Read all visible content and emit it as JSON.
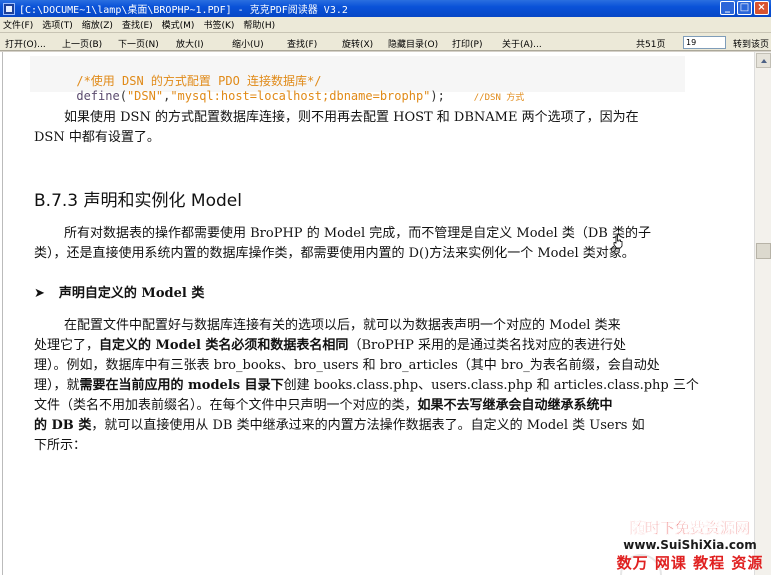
{
  "window": {
    "title": "[C:\\DOCUME~1\\lamp\\桌面\\BROPHP~1.PDF] - 克克PDF阅读器 V3.2",
    "minimize": "_",
    "maximize": "□",
    "close": "×"
  },
  "menu": [
    "文件(F)",
    "选项(T)",
    "缩放(Z)",
    "查找(E)",
    "模式(M)",
    "书签(K)",
    "帮助(H)"
  ],
  "toolbar": {
    "open": "打开(O)...",
    "prev": "上一页(B)",
    "next": "下一页(N)",
    "zoom_in": "放大(I)",
    "zoom_out": "缩小(U)",
    "find": "查找(F)",
    "rotate": "旋转(X)",
    "toc": "隐藏目录(O)",
    "print": "打印(P)",
    "about": "关于(A)...",
    "page_count": "共51页",
    "page_input": "19",
    "goto": "转到该页"
  },
  "doc": {
    "code_comment": "/*使用 DSN 的方式配置 PDO 连接数据库*/",
    "code_kw": "define",
    "code_open": "(",
    "code_str1": "\"DSN\"",
    "code_comma": ",",
    "code_str2": "\"mysql:host=localhost;dbname=brophp\"",
    "code_close": ");",
    "code_cmt2": "//DSN 方式",
    "p1_l1": "如果使用 DSN 的方式配置数据库连接，则不用再去配置 HOST 和 DBNAME 两个选项了，因为在",
    "p1_l2": "DSN 中都有设置了。",
    "heading": "B.7.3 声明和实例化 Model",
    "p2_l1": "所有对数据表的操作都需要使用 BroPHP 的 Model 完成，而不管理是自定义 Model 类（DB 类的子",
    "p2_l2": "类），还是直接使用系统内置的数据库操作类，都需要使用内置的 D()方法来实例化一个 Model 类对象。",
    "bullet": "➤",
    "subhead": "声明自定义的 Model 类",
    "p3_l1": "在配置文件中配置好与数据库连接有关的选项以后，就可以为数据表声明一个对应的 Model 类来",
    "p3_l2a": "处理它了，",
    "p3_l2b": "自定义的 Model 类名必须和数据表名相同",
    "p3_l2c": "（BroPHP 采用的是通过类名找对应的表进行处",
    "p3_l3": "理）。例如，数据库中有三张表 bro_books、bro_users 和 bro_articles（其中 bro_为表名前缀，会自动处",
    "p3_l4a": "理），就",
    "p3_l4b": "需要在当前应用的 models 目录下",
    "p3_l4c": "创建 books.class.php、users.class.php 和 articles.class.php 三个",
    "p3_l5a": "文件（类名不用加表前缀名）。在每个文件中只声明一个对应的类，",
    "p3_l5b": "如果不去写继承会自动继承系统中",
    "p3_l6a": "的 DB 类",
    "p3_l6b": "，就可以直接使用从 DB 类中继承过来的内置方法操作数据表了。自定义的 Model 类 Users 如",
    "p3_l7": "下所示："
  },
  "watermark": {
    "line1": "随时下免费资源网",
    "line2": "www.SuiShiXia.com",
    "line3": "数万 网课 教程 资源"
  }
}
